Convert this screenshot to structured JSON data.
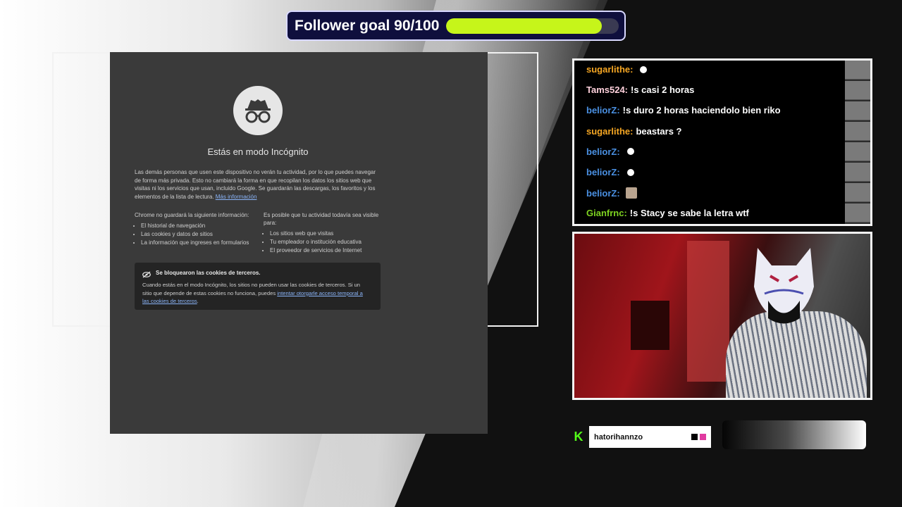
{
  "goal": {
    "label": "Follower goal 90/100",
    "current": 90,
    "target": 100,
    "fill_color": "#c6f51a"
  },
  "browser": {
    "title": "Estás en modo Incógnito",
    "intro": "Las demás personas que usen este dispositivo no verán tu actividad, por lo que puedes navegar de forma más privada. Esto no cambiará la forma en que recopilan los datos los sitios web que visitas ni los servicios que usan, incluido Google. Se guardarán las descargas, los favoritos y los elementos de la lista de lectura.",
    "more_info_link": "Más información",
    "left_col": {
      "title": "Chrome no guardará la siguiente información:",
      "items": [
        "El historial de navegación",
        "Las cookies y datos de sitios",
        "La información que ingreses en formularios"
      ]
    },
    "right_col": {
      "title": "Es posible que tu actividad todavía sea visible para:",
      "items": [
        "Los sitios web que visitas",
        "Tu empleador o institución educativa",
        "El proveedor de servicios de Internet"
      ]
    },
    "cookies": {
      "title": "Se bloquearon las cookies de terceros.",
      "text": "Cuando estás en el modo Incógnito, los sitios no pueden usar las cookies de terceros. Si un sitio que depende de estas cookies no funciona, puedes",
      "link": "intentar otorgarle acceso temporal a las cookies de terceros",
      "end": "."
    }
  },
  "chat": {
    "messages": [
      {
        "user": "sugarlithe:",
        "text": "",
        "color": "#f5a623",
        "emote": "dot"
      },
      {
        "user": "Tams524:",
        "text": "!s casi 2 horas",
        "color": "#ffd1dc",
        "emote": ""
      },
      {
        "user": "beliorZ:",
        "text": "!s duro 2 horas haciendolo bien riko",
        "color": "#4a90e2",
        "emote": ""
      },
      {
        "user": "sugarlithe:",
        "text": "beastars ?",
        "color": "#f5a623",
        "emote": ""
      },
      {
        "user": "beliorZ:",
        "text": "",
        "color": "#4a90e2",
        "emote": "dot"
      },
      {
        "user": "beliorZ:",
        "text": "",
        "color": "#4a90e2",
        "emote": "dot"
      },
      {
        "user": "beliorZ:",
        "text": "",
        "color": "#4a90e2",
        "emote": "img"
      },
      {
        "user": "Gianfrnc:",
        "text": "!s Stacy se sabe la letra wtf",
        "color": "#7ed321",
        "emote": ""
      }
    ]
  },
  "profile": {
    "logo": "K",
    "username": "hatorihannzo"
  }
}
